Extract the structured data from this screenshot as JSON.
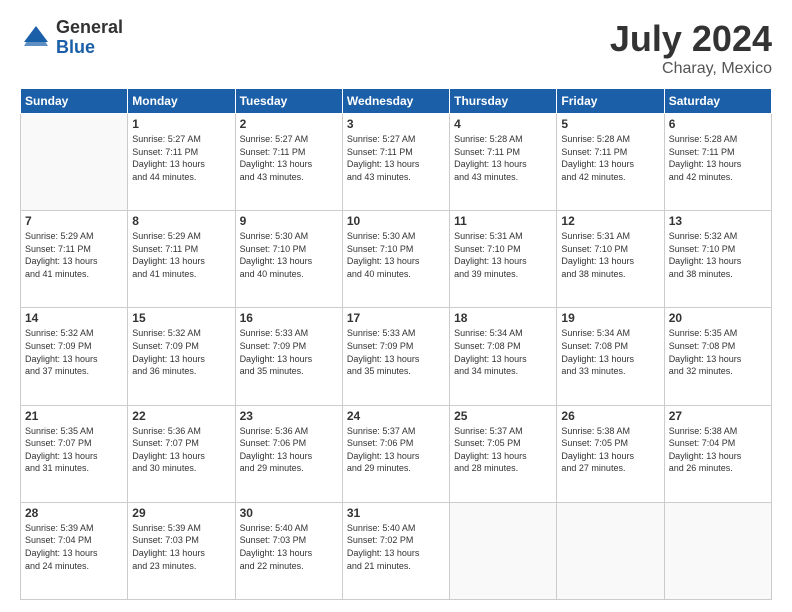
{
  "header": {
    "logo_general": "General",
    "logo_blue": "Blue",
    "title": "July 2024",
    "location": "Charay, Mexico"
  },
  "days_of_week": [
    "Sunday",
    "Monday",
    "Tuesday",
    "Wednesday",
    "Thursday",
    "Friday",
    "Saturday"
  ],
  "weeks": [
    [
      {
        "day": "",
        "info": ""
      },
      {
        "day": "1",
        "info": "Sunrise: 5:27 AM\nSunset: 7:11 PM\nDaylight: 13 hours\nand 44 minutes."
      },
      {
        "day": "2",
        "info": "Sunrise: 5:27 AM\nSunset: 7:11 PM\nDaylight: 13 hours\nand 43 minutes."
      },
      {
        "day": "3",
        "info": "Sunrise: 5:27 AM\nSunset: 7:11 PM\nDaylight: 13 hours\nand 43 minutes."
      },
      {
        "day": "4",
        "info": "Sunrise: 5:28 AM\nSunset: 7:11 PM\nDaylight: 13 hours\nand 43 minutes."
      },
      {
        "day": "5",
        "info": "Sunrise: 5:28 AM\nSunset: 7:11 PM\nDaylight: 13 hours\nand 42 minutes."
      },
      {
        "day": "6",
        "info": "Sunrise: 5:28 AM\nSunset: 7:11 PM\nDaylight: 13 hours\nand 42 minutes."
      }
    ],
    [
      {
        "day": "7",
        "info": "Sunrise: 5:29 AM\nSunset: 7:11 PM\nDaylight: 13 hours\nand 41 minutes."
      },
      {
        "day": "8",
        "info": "Sunrise: 5:29 AM\nSunset: 7:11 PM\nDaylight: 13 hours\nand 41 minutes."
      },
      {
        "day": "9",
        "info": "Sunrise: 5:30 AM\nSunset: 7:10 PM\nDaylight: 13 hours\nand 40 minutes."
      },
      {
        "day": "10",
        "info": "Sunrise: 5:30 AM\nSunset: 7:10 PM\nDaylight: 13 hours\nand 40 minutes."
      },
      {
        "day": "11",
        "info": "Sunrise: 5:31 AM\nSunset: 7:10 PM\nDaylight: 13 hours\nand 39 minutes."
      },
      {
        "day": "12",
        "info": "Sunrise: 5:31 AM\nSunset: 7:10 PM\nDaylight: 13 hours\nand 38 minutes."
      },
      {
        "day": "13",
        "info": "Sunrise: 5:32 AM\nSunset: 7:10 PM\nDaylight: 13 hours\nand 38 minutes."
      }
    ],
    [
      {
        "day": "14",
        "info": "Sunrise: 5:32 AM\nSunset: 7:09 PM\nDaylight: 13 hours\nand 37 minutes."
      },
      {
        "day": "15",
        "info": "Sunrise: 5:32 AM\nSunset: 7:09 PM\nDaylight: 13 hours\nand 36 minutes."
      },
      {
        "day": "16",
        "info": "Sunrise: 5:33 AM\nSunset: 7:09 PM\nDaylight: 13 hours\nand 35 minutes."
      },
      {
        "day": "17",
        "info": "Sunrise: 5:33 AM\nSunset: 7:09 PM\nDaylight: 13 hours\nand 35 minutes."
      },
      {
        "day": "18",
        "info": "Sunrise: 5:34 AM\nSunset: 7:08 PM\nDaylight: 13 hours\nand 34 minutes."
      },
      {
        "day": "19",
        "info": "Sunrise: 5:34 AM\nSunset: 7:08 PM\nDaylight: 13 hours\nand 33 minutes."
      },
      {
        "day": "20",
        "info": "Sunrise: 5:35 AM\nSunset: 7:08 PM\nDaylight: 13 hours\nand 32 minutes."
      }
    ],
    [
      {
        "day": "21",
        "info": "Sunrise: 5:35 AM\nSunset: 7:07 PM\nDaylight: 13 hours\nand 31 minutes."
      },
      {
        "day": "22",
        "info": "Sunrise: 5:36 AM\nSunset: 7:07 PM\nDaylight: 13 hours\nand 30 minutes."
      },
      {
        "day": "23",
        "info": "Sunrise: 5:36 AM\nSunset: 7:06 PM\nDaylight: 13 hours\nand 29 minutes."
      },
      {
        "day": "24",
        "info": "Sunrise: 5:37 AM\nSunset: 7:06 PM\nDaylight: 13 hours\nand 29 minutes."
      },
      {
        "day": "25",
        "info": "Sunrise: 5:37 AM\nSunset: 7:05 PM\nDaylight: 13 hours\nand 28 minutes."
      },
      {
        "day": "26",
        "info": "Sunrise: 5:38 AM\nSunset: 7:05 PM\nDaylight: 13 hours\nand 27 minutes."
      },
      {
        "day": "27",
        "info": "Sunrise: 5:38 AM\nSunset: 7:04 PM\nDaylight: 13 hours\nand 26 minutes."
      }
    ],
    [
      {
        "day": "28",
        "info": "Sunrise: 5:39 AM\nSunset: 7:04 PM\nDaylight: 13 hours\nand 24 minutes."
      },
      {
        "day": "29",
        "info": "Sunrise: 5:39 AM\nSunset: 7:03 PM\nDaylight: 13 hours\nand 23 minutes."
      },
      {
        "day": "30",
        "info": "Sunrise: 5:40 AM\nSunset: 7:03 PM\nDaylight: 13 hours\nand 22 minutes."
      },
      {
        "day": "31",
        "info": "Sunrise: 5:40 AM\nSunset: 7:02 PM\nDaylight: 13 hours\nand 21 minutes."
      },
      {
        "day": "",
        "info": ""
      },
      {
        "day": "",
        "info": ""
      },
      {
        "day": "",
        "info": ""
      }
    ]
  ]
}
